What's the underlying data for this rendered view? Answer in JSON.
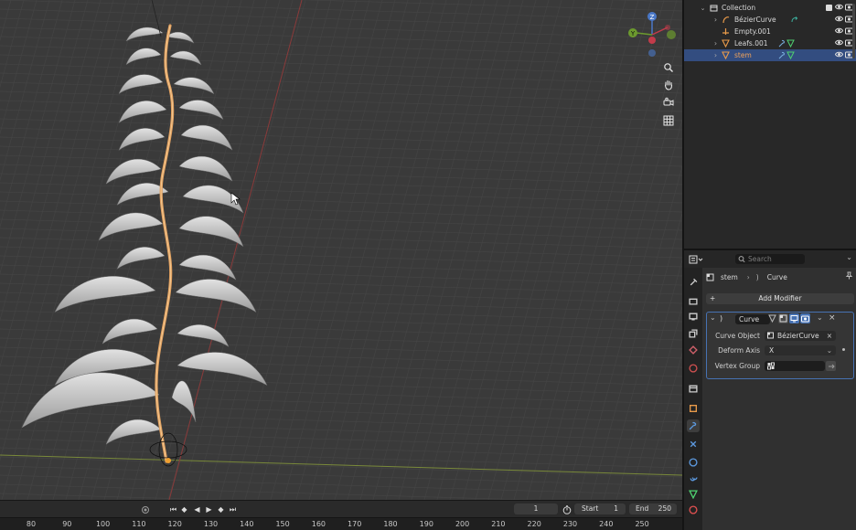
{
  "viewport": {
    "navigation": {
      "z_axis": "Z",
      "y_axis": "Y",
      "x_axis": "X"
    },
    "tools": [
      {
        "name": "zoom-icon"
      },
      {
        "name": "hand-pan-icon"
      },
      {
        "name": "camera-view-icon"
      },
      {
        "name": "grid-ortho-icon"
      }
    ],
    "colors": {
      "background": "#3a3a3a",
      "grid_line": "#444444",
      "x_axis_line": "#8a3a3a",
      "y_axis_line": "#7a8a3a",
      "stem": "#e0a060",
      "leaf": "#c8c8c8",
      "leaf_shadow": "#8c8c8c"
    }
  },
  "timeline": {
    "current_frame": "1",
    "start_label": "Start",
    "start_value": "1",
    "end_label": "End",
    "end_value": "250",
    "ruler_ticks": [
      "80",
      "90",
      "100",
      "110",
      "120",
      "130",
      "140",
      "150",
      "160",
      "170",
      "180",
      "190",
      "200",
      "210",
      "220",
      "230",
      "240",
      "250"
    ]
  },
  "outliner": {
    "collection_label": "Collection",
    "items": [
      {
        "name": "BézierCurve",
        "icon": "curve-icon",
        "extra": "modifier-icon"
      },
      {
        "name": "Empty.001",
        "icon": "empty-icon"
      },
      {
        "name": "Leafs.001",
        "icon": "mesh-icon",
        "extra": "wrench-icon"
      },
      {
        "name": "stem",
        "icon": "mesh-icon",
        "extra": "wrench-icon",
        "selected": true
      }
    ]
  },
  "properties": {
    "search_placeholder": "Search",
    "breadcrumb": {
      "object": "stem",
      "modifier": "Curve"
    },
    "add_modifier_label": "Add Modifier",
    "modifier": {
      "name": "Curve",
      "curve_object_label": "Curve Object",
      "curve_object_value": "BézierCurve",
      "deform_axis_label": "Deform Axis",
      "deform_axis_value": "X",
      "vertex_group_label": "Vertex Group",
      "vertex_group_value": ""
    },
    "accent_color": "#4772b3"
  }
}
